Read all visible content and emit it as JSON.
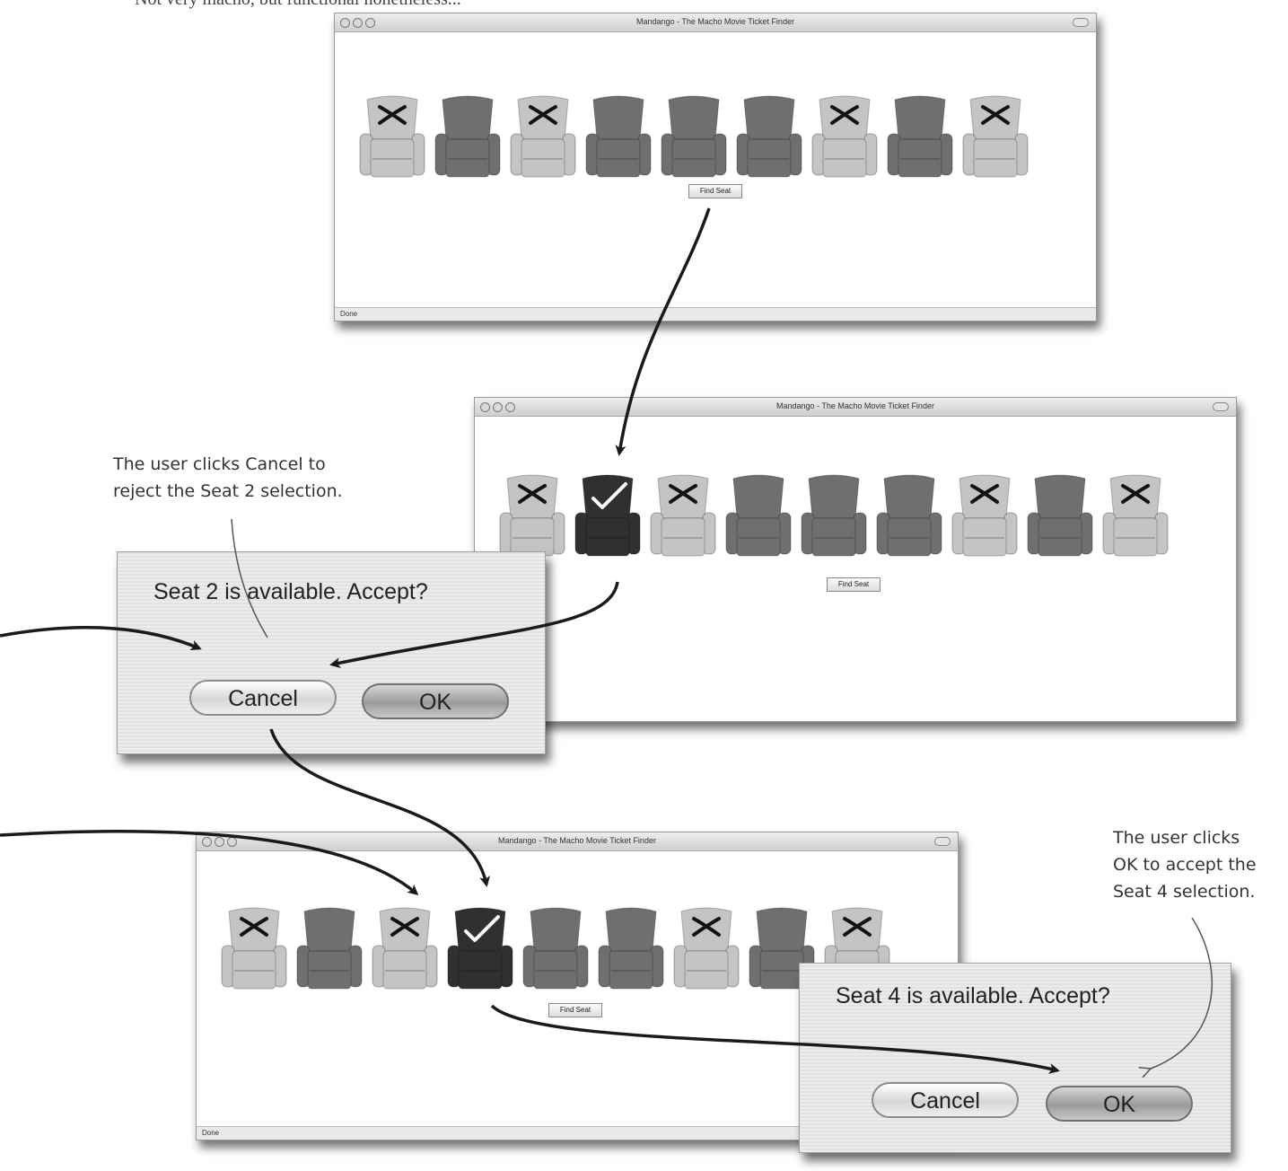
{
  "caption": "Not very macho, but functional nonetheless...",
  "windows": [
    {
      "title": "Mandango - The Macho Movie Ticket Finder",
      "status": "Done",
      "find_button": "Find Seat",
      "seats": [
        {
          "seat": 1,
          "state": "taken"
        },
        {
          "seat": 2,
          "state": "available"
        },
        {
          "seat": 3,
          "state": "taken"
        },
        {
          "seat": 4,
          "state": "available"
        },
        {
          "seat": 5,
          "state": "available"
        },
        {
          "seat": 6,
          "state": "available"
        },
        {
          "seat": 7,
          "state": "taken"
        },
        {
          "seat": 8,
          "state": "available"
        },
        {
          "seat": 9,
          "state": "taken"
        }
      ]
    },
    {
      "title": "Mandango - The Macho Movie Ticket Finder",
      "status": "",
      "find_button": "Find Seat",
      "seats": [
        {
          "seat": 1,
          "state": "taken"
        },
        {
          "seat": 2,
          "state": "selected"
        },
        {
          "seat": 3,
          "state": "taken"
        },
        {
          "seat": 4,
          "state": "available"
        },
        {
          "seat": 5,
          "state": "available"
        },
        {
          "seat": 6,
          "state": "available"
        },
        {
          "seat": 7,
          "state": "taken"
        },
        {
          "seat": 8,
          "state": "available"
        },
        {
          "seat": 9,
          "state": "taken"
        }
      ]
    },
    {
      "title": "Mandango - The Macho Movie Ticket Finder",
      "status": "Done",
      "find_button": "Find Seat",
      "seats": [
        {
          "seat": 1,
          "state": "taken"
        },
        {
          "seat": 2,
          "state": "available"
        },
        {
          "seat": 3,
          "state": "taken"
        },
        {
          "seat": 4,
          "state": "selected"
        },
        {
          "seat": 5,
          "state": "available"
        },
        {
          "seat": 6,
          "state": "available"
        },
        {
          "seat": 7,
          "state": "taken"
        },
        {
          "seat": 8,
          "state": "available"
        },
        {
          "seat": 9,
          "state": "taken"
        }
      ]
    }
  ],
  "dialogs": [
    {
      "message": "Seat 2 is available. Accept?",
      "cancel": "Cancel",
      "ok": "OK"
    },
    {
      "message": "Seat 4 is available. Accept?",
      "cancel": "Cancel",
      "ok": "OK"
    }
  ],
  "annotations": {
    "cancel_note": "The user clicks Cancel to\nreject the Seat 2 selection.",
    "ok_note": "The user clicks\nOK to accept the\nSeat 4 selection."
  },
  "colors": {
    "taken_seat": "#c4c4c4",
    "available_seat": "#6f6f6f",
    "selected_seat": "#303030"
  }
}
